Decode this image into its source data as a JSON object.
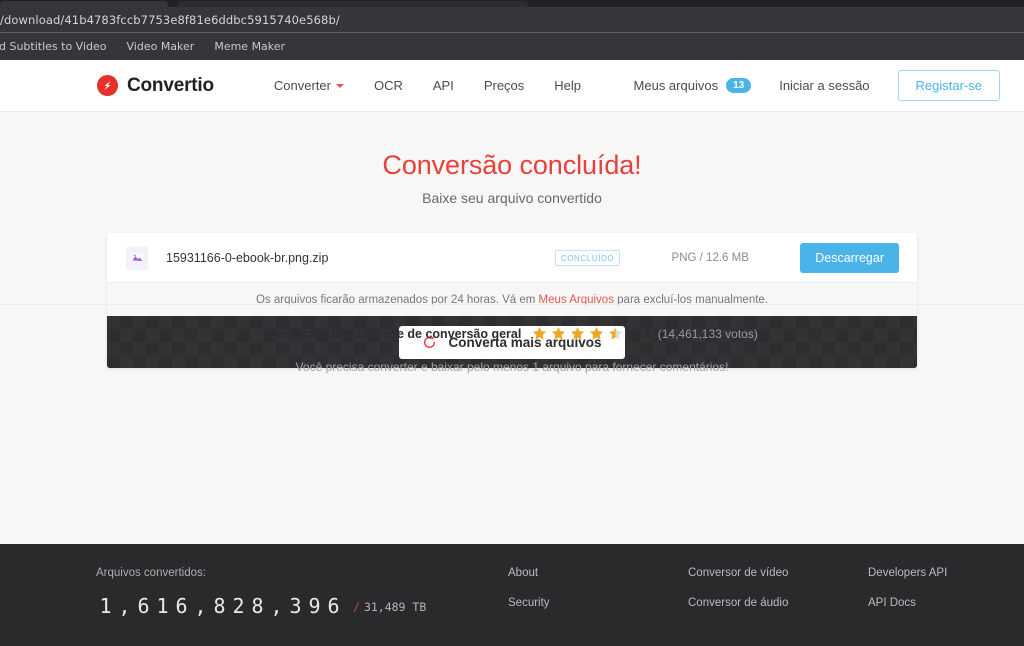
{
  "browser": {
    "url": "/download/41b4783fccb7753e8f81e6ddbc5915740e568b/",
    "bookmarks": [
      "dd Subtitles to Video",
      "Video Maker",
      "Meme Maker"
    ]
  },
  "header": {
    "brand": "Convertio",
    "brand_logo_icon": "convertio-logo-icon",
    "nav": [
      {
        "label": "Converter",
        "has_caret": true
      },
      {
        "label": "OCR",
        "has_caret": false
      },
      {
        "label": "API",
        "has_caret": false
      },
      {
        "label": "Preços",
        "has_caret": false
      },
      {
        "label": "Help",
        "has_caret": false
      }
    ],
    "my_files_label": "Meus arquivos",
    "my_files_count": "13",
    "signin_label": "Iniciar a sessão",
    "signup_label": "Registar-se"
  },
  "hero": {
    "title": "Conversão concluída!",
    "subtitle": "Baixe seu arquivo convertido"
  },
  "card": {
    "file": {
      "icon": "image-file-icon",
      "name": "15931166-0-ebook-br.png.zip",
      "status": "CONCLUÍDO",
      "meta": "PNG / 12.6 MB",
      "download_label": "Descarregar"
    },
    "info_prefix": "Os arquivos ficarão armazenados por 24 horas. Vá em ",
    "info_link": "Meus Arquivos",
    "info_suffix": " para excluí-los manualmente.",
    "convert_more_label": "Converta mais arquivos",
    "refresh_icon": "refresh-icon"
  },
  "rating": {
    "label": "Avaliação de qualidade de conversão geral",
    "score": "4.6",
    "stars_filled": 4,
    "stars_half": 1,
    "stars_total": 5,
    "votes": "(14,461,133 votos)",
    "feedback_note": "Você precisa converter e baixar pelo menos 1 arquivo para fornecer comentários!"
  },
  "footer": {
    "stats_label": "Arquivos convertidos:",
    "converted_count": "1,616,828,396",
    "bytes_slash": "/",
    "bytes_total": "31,489 TB",
    "columns": [
      [
        "About",
        "Security"
      ],
      [
        "Conversor de vídeo",
        "Conversor de áudio"
      ],
      [
        "Developers API",
        "API Docs"
      ]
    ]
  },
  "colors": {
    "brand_red": "#e8413a",
    "accent_blue": "#4ab3e8",
    "star_gold": "#f5a623",
    "dark_bar": "#333336",
    "footer_bg": "#2a2a2c"
  }
}
